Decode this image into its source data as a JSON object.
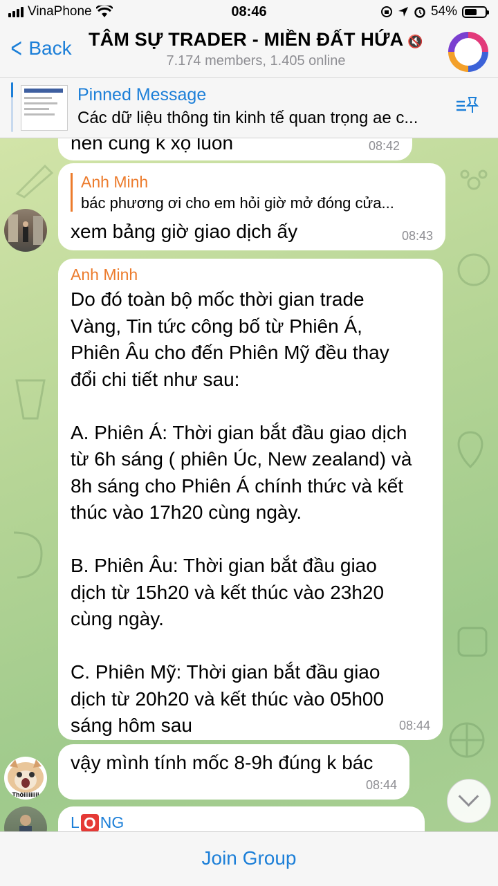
{
  "status_bar": {
    "carrier": "VinaPhone",
    "time": "08:46",
    "battery": "54%"
  },
  "header": {
    "back_label": "Back",
    "title": "TÂM SỰ TRADER - MIỀN ĐẤT HỨA",
    "subtitle": "7.174 members, 1.405 online"
  },
  "pinned": {
    "label": "Pinned Message",
    "text": "Các dữ liệu thông tin kinh tế quan trọng ae c..."
  },
  "messages": [
    {
      "text": "nên cũng k xộ luôn",
      "time": "08:42"
    },
    {
      "reply_name": "Anh Minh",
      "reply_text": "bác phương ơi cho em hỏi giờ mở đóng cửa...",
      "text": "xem bảng giờ giao dịch ấy",
      "time": "08:43"
    },
    {
      "sender": "Anh Minh",
      "text": "Do đó toàn bộ mốc thời gian trade\nVàng, Tin tức công bố từ Phiên Á,\nPhiên Âu cho đến Phiên Mỹ đều thay\nđổi chi tiết như sau:\n\nA. Phiên Á: Thời gian bắt đầu giao dịch\ntừ 6h sáng ( phiên Úc, New zealand) và\n8h sáng cho Phiên Á chính thức và kết\nthúc vào 17h20 cùng ngày.\n\nB. Phiên Âu: Thời gian bắt đầu giao\ndịch từ 15h20 và kết thúc vào 23h20\ncùng ngày.\n\nC. Phiên Mỹ: Thời gian bắt đầu giao\ndịch từ 20h20 và kết thúc vào 05h00\nsáng hôm sau",
      "time": "08:44"
    },
    {
      "text": "vậy mình tính mốc 8-9h đúng k bác",
      "time": "08:44",
      "avatar_caption": "Thôiiiiiiiii"
    },
    {
      "sender_start": "L",
      "sender_emoji": "O",
      "sender_end": "NG"
    }
  ],
  "footer": {
    "join_label": "Join Group"
  },
  "colors": {
    "accent": "#1c7fd8",
    "sender_name": "#ec7b2c"
  }
}
